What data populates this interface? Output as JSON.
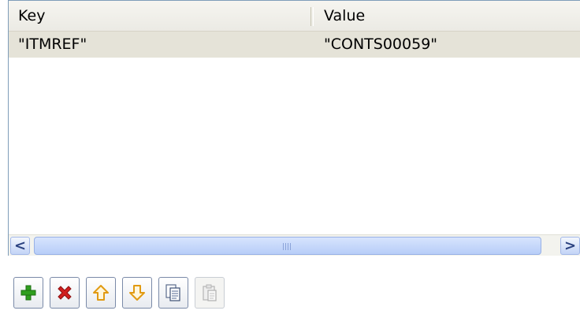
{
  "table": {
    "columns": [
      "Key",
      "Value"
    ],
    "rows": [
      {
        "key": "\"ITMREF\"",
        "value": "\"CONTS00059\""
      }
    ]
  },
  "scrollbar": {
    "left_arrow": "<",
    "right_arrow": ">"
  },
  "toolbar": {
    "buttons": [
      {
        "icon": "plus-icon",
        "enabled": true
      },
      {
        "icon": "delete-x-icon",
        "enabled": true
      },
      {
        "icon": "arrow-up-icon",
        "enabled": true
      },
      {
        "icon": "arrow-down-icon",
        "enabled": true
      },
      {
        "icon": "copy-icon",
        "enabled": true
      },
      {
        "icon": "paste-icon",
        "enabled": false
      }
    ]
  },
  "colors": {
    "selected_row": "#e5e3d8",
    "add_green": "#2f9e1e",
    "delete_red": "#d11f1f",
    "arrow_orange": "#e19a12"
  }
}
